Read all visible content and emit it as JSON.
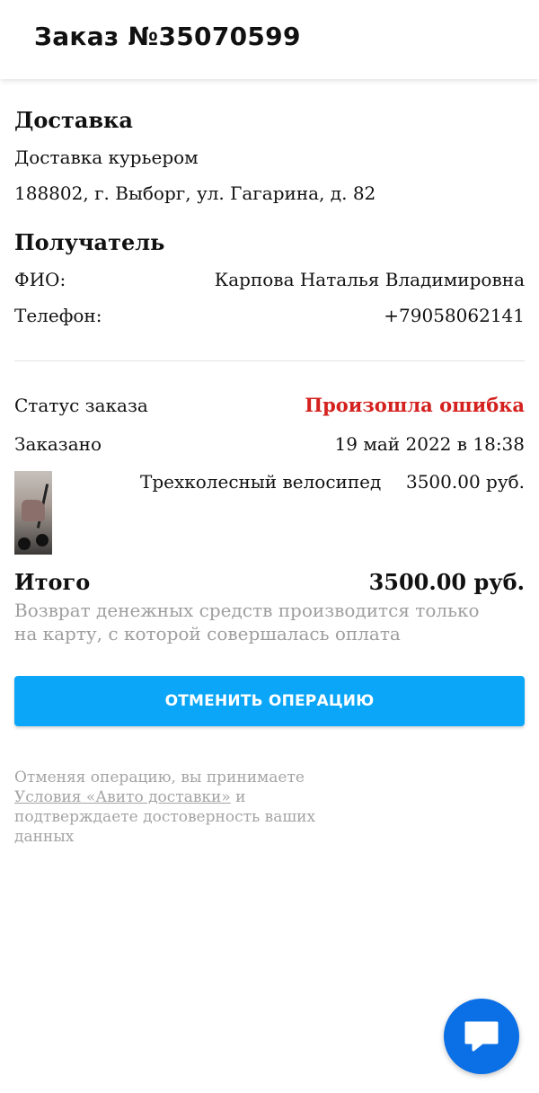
{
  "header": {
    "title": "Заказ №35070599"
  },
  "delivery": {
    "heading": "Доставка",
    "method": "Доставка курьером",
    "address": "188802, г. Выборг, ул. Гагарина, д. 82"
  },
  "recipient": {
    "heading": "Получатель",
    "name_label": "ФИО:",
    "name_value": "Карпова Наталья Владимировна",
    "phone_label": "Телефон:",
    "phone_value": "+79058062141"
  },
  "order": {
    "status_label": "Статус заказа",
    "status_value": "Произошла ошибка",
    "status_color": "#d4211e",
    "ordered_label": "Заказано",
    "ordered_value": "19 май 2022 в 18:38",
    "item": {
      "name": "Трехколесный велосипед",
      "price": "3500.00 руб.",
      "thumbnail": "tricycle-photo"
    }
  },
  "total": {
    "label": "Итого",
    "value": "3500.00 руб.",
    "refund_note_line1": "Возврат денежных средств производится только",
    "refund_note_line2": "на карту, с которой совершалась оплата"
  },
  "actions": {
    "cancel_label": "ОТМЕНИТЬ ОПЕРАЦИЮ",
    "cancel_color": "#0ba6f7"
  },
  "terms": {
    "prefix": "Отменяя операцию, вы принимаете",
    "link": "Условия «Авито доставки»",
    "suffix": " и подтверждаете достоверность ваших данных"
  },
  "chat": {
    "icon": "chat-icon",
    "color": "#0b6fe6"
  }
}
